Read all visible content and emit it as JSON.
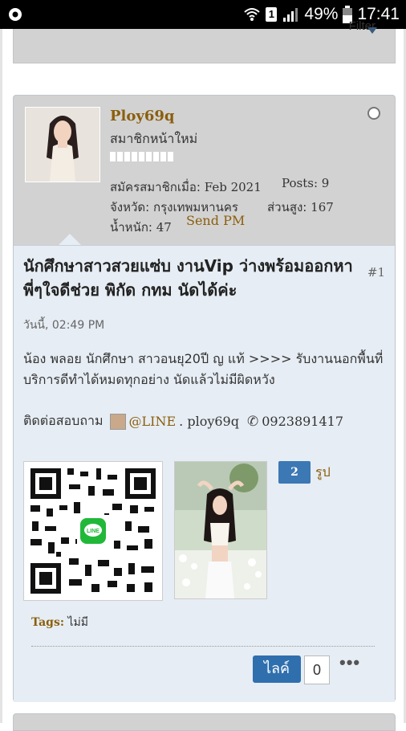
{
  "status_bar": {
    "battery_percent": "49%",
    "time": "17:41",
    "sim_slot": "1"
  },
  "top_bar": {
    "filter_label": "Filter"
  },
  "post": {
    "author": {
      "username": "Ploy69q",
      "user_title": "สมาชิกหน้าใหม่",
      "joined_label": "สมัครสมาชิกเมื่อ:",
      "joined_value": "Feb 2021",
      "posts_label": "Posts:",
      "posts_value": "9",
      "province_label": "จังหวัด:",
      "province_value": "กรุงเทพมหานคร",
      "height_label": "ส่วนสูง:",
      "height_value": "167",
      "weight_label": "น้ำหนัก:",
      "weight_value": "47",
      "send_pm": "Send PM"
    },
    "number": "#1",
    "title": "นักศึกษาสาวสวยแซ่บ งานVip ว่างพร้อมออกหาพี่ๆใจดีช่วย พิกัด กทม นัดได้ค่ะ",
    "date": "วันนี้, 02:49 PM",
    "body": "น้อง พลอย นักศึกษา สาวอนยุ20ปี ญ แท้ >>>> รับงานนอกพื้นที่ บริการดีทำได้หมดทุกอย่าง นัดแล้วไม่มีผิดหวัง",
    "contact": {
      "prefix": "ติดต่อสอบถาม",
      "line_link": "@LINE",
      "line_id": ". ploy69q",
      "phone": "0923891417"
    },
    "images_count": "2",
    "images_unit": "รูป",
    "tags_label": "Tags:",
    "tags_value": "ไม่มี",
    "like_label": "ไลค์",
    "like_count": "0"
  },
  "icons": {
    "notification": "settings-icon",
    "wifi": "wifi-icon",
    "signal": "signal-icon",
    "battery": "battery-icon",
    "phone": "phone-icon",
    "more": "more-icon"
  }
}
